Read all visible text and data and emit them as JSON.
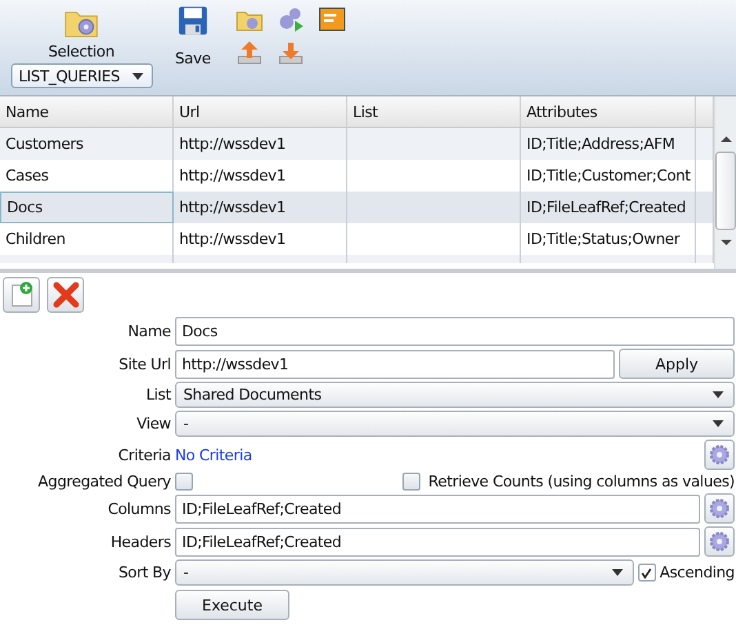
{
  "toolbar": {
    "selection": {
      "label": "Selection",
      "value": "LIST_QUERIES"
    },
    "save_label": "Save"
  },
  "table": {
    "columns": [
      "Name",
      "Url",
      "List",
      "Attributes"
    ],
    "rows": [
      {
        "cells": [
          "Customers",
          "http://wssdev1",
          "",
          "ID;Title;Address;AFM"
        ],
        "selected": false
      },
      {
        "cells": [
          "Cases",
          "http://wssdev1",
          "",
          "ID;Title;Customer;Cont"
        ],
        "selected": false
      },
      {
        "cells": [
          "Docs",
          "http://wssdev1",
          "",
          "ID;FileLeafRef;Created"
        ],
        "selected": true
      },
      {
        "cells": [
          "Children",
          "http://wssdev1",
          "",
          "ID;Title;Status;Owner"
        ],
        "selected": false
      }
    ]
  },
  "form": {
    "name": {
      "label": "Name",
      "value": "Docs"
    },
    "site_url": {
      "label": "Site Url",
      "value": "http://wssdev1",
      "button": "Apply"
    },
    "list": {
      "label": "List",
      "value": "Shared Documents"
    },
    "view": {
      "label": "View",
      "value": "-"
    },
    "criteria": {
      "label": "Criteria",
      "value": "No Criteria"
    },
    "aggregated": {
      "label": "Aggregated Query",
      "checked": false
    },
    "retrieve_counts": {
      "label": "Retrieve Counts (using columns as values)",
      "checked": false
    },
    "columns": {
      "label": "Columns",
      "value": "ID;FileLeafRef;Created"
    },
    "headers": {
      "label": "Headers",
      "value": "ID;FileLeafRef;Created"
    },
    "sort_by": {
      "label": "Sort By",
      "value": "-"
    },
    "ascending": {
      "label": "Ascending",
      "checked": true
    },
    "execute": "Execute"
  }
}
